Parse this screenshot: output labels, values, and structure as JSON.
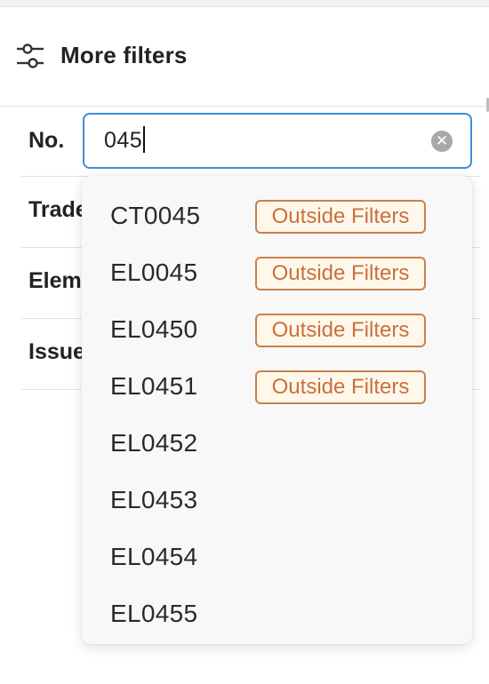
{
  "header": {
    "title": "More filters",
    "icon": "sliders-icon"
  },
  "filters": {
    "number": {
      "label": "No.",
      "value": "045",
      "clear_icon": "clear-icon"
    },
    "trade": {
      "label": "Trade"
    },
    "element": {
      "label": "Element"
    },
    "issue": {
      "label": "Issue"
    }
  },
  "dropdown": {
    "options": [
      {
        "label": "CT0045",
        "badge": "Outside Filters"
      },
      {
        "label": "EL0045",
        "badge": "Outside Filters"
      },
      {
        "label": "EL0450",
        "badge": "Outside Filters"
      },
      {
        "label": "EL0451",
        "badge": "Outside Filters"
      },
      {
        "label": "EL0452"
      },
      {
        "label": "EL0453"
      },
      {
        "label": "EL0454"
      },
      {
        "label": "EL0455"
      }
    ]
  },
  "colors": {
    "focus_border": "#3a8fd9",
    "badge_border": "#c8804d",
    "badge_text": "#c8703f",
    "badge_bg": "#fff8ea"
  }
}
